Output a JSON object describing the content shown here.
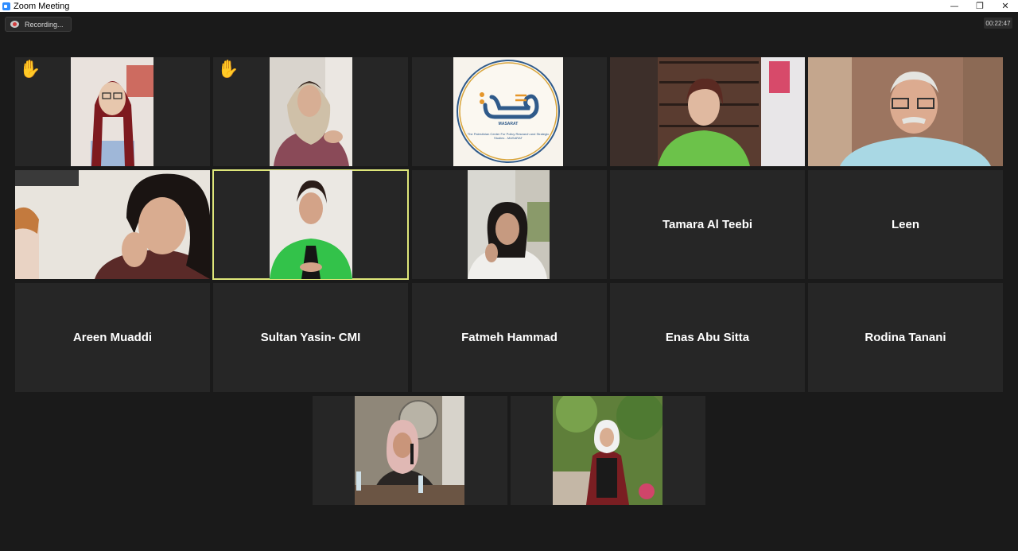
{
  "window": {
    "title": "Zoom Meeting",
    "controls": {
      "minimize": "—",
      "restore": "❐",
      "close": "✕"
    }
  },
  "recording": {
    "label": "Recording..."
  },
  "timer": {
    "value": "00:22:47"
  },
  "colors": {
    "background": "#1a1a1a",
    "tile": "#262626",
    "active_speaker_border": "#dfe77a",
    "raised_hand": "#f6c23e"
  },
  "participants": [
    {
      "id": "p1",
      "video": true,
      "hand_raised": true
    },
    {
      "id": "p2",
      "video": true,
      "hand_raised": true
    },
    {
      "id": "p3",
      "video": true,
      "logo_text": "MASARAT",
      "logo_subtitle": "The Palestinian Center For Policy Research and Strategic Studies - MASARAT"
    },
    {
      "id": "p4",
      "video": true
    },
    {
      "id": "p5",
      "video": true
    },
    {
      "id": "p6",
      "video": true
    },
    {
      "id": "p7",
      "video": true,
      "active_speaker": true
    },
    {
      "id": "p8",
      "video": true
    },
    {
      "id": "p9",
      "name": "Tamara Al Teebi",
      "video": false
    },
    {
      "id": "p10",
      "name": "Leen",
      "video": false
    },
    {
      "id": "p11",
      "name": "Areen Muaddi",
      "video": false
    },
    {
      "id": "p12",
      "name": "Sultan Yasin- CMI",
      "video": false
    },
    {
      "id": "p13",
      "name": "Fatmeh Hammad",
      "video": false
    },
    {
      "id": "p14",
      "name": "Enas Abu Sitta",
      "video": false
    },
    {
      "id": "p15",
      "name": "Rodina Tanani",
      "video": false
    },
    {
      "id": "p16",
      "video": true
    },
    {
      "id": "p17",
      "video": true
    }
  ],
  "icons": {
    "raised_hand": "✋"
  }
}
